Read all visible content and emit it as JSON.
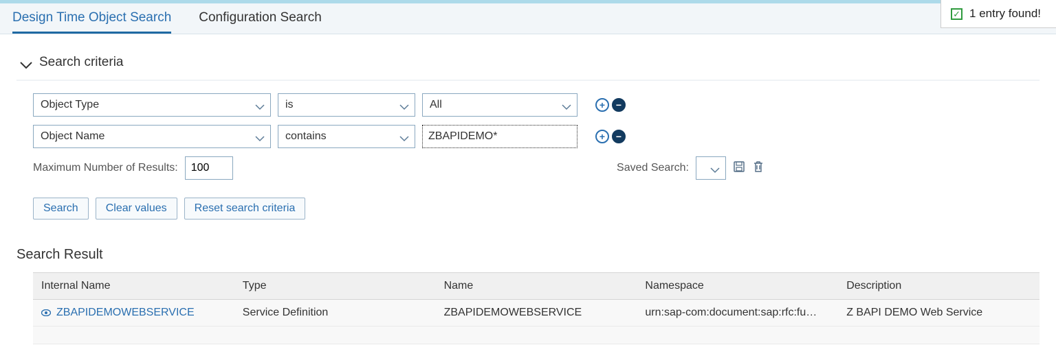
{
  "notification": {
    "text": "1 entry found!"
  },
  "tabs": [
    {
      "label": "Design Time Object Search",
      "active": true
    },
    {
      "label": "Configuration Search",
      "active": false
    }
  ],
  "criteria_section": {
    "title": "Search criteria"
  },
  "criteria_rows": [
    {
      "field": "Object Type",
      "operator": "is",
      "value": "All",
      "value_is_dropdown": true
    },
    {
      "field": "Object Name",
      "operator": "contains",
      "value": "ZBAPIDEMO*",
      "value_is_dropdown": false
    }
  ],
  "max_results": {
    "label": "Maximum Number of Results:",
    "value": "100"
  },
  "saved_search": {
    "label": "Saved Search:"
  },
  "buttons": {
    "search": "Search",
    "clear": "Clear values",
    "reset": "Reset search criteria"
  },
  "result_section": {
    "title": "Search Result"
  },
  "result_columns": [
    "Internal Name",
    "Type",
    "Name",
    "Namespace",
    "Description"
  ],
  "result_rows": [
    {
      "internal_name": "ZBAPIDEMOWEBSERVICE",
      "type": "Service Definition",
      "name": "ZBAPIDEMOWEBSERVICE",
      "namespace": "urn:sap-com:document:sap:rfc:fu…",
      "description": "Z BAPI DEMO Web Service"
    }
  ]
}
